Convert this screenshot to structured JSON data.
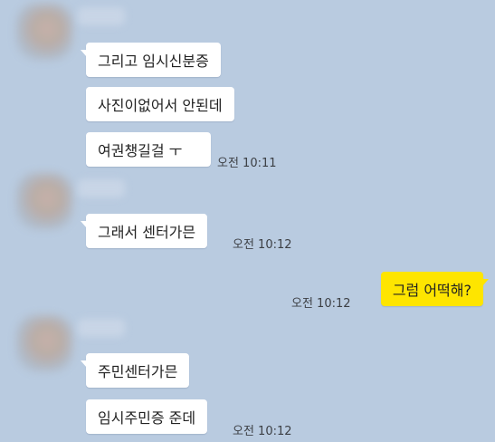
{
  "chat": {
    "group1": {
      "messages": [
        "그리고 임시신분증",
        "사진이없어서 안된데",
        "여권챙길걸 ㅜ"
      ],
      "time": "오전 10:11"
    },
    "group2": {
      "messages": [
        "그래서 센터가믄"
      ],
      "time": "오전 10:12"
    },
    "mine": {
      "message": "그럼 어떡해?",
      "time": "오전 10:12"
    },
    "group3": {
      "messages": [
        "주민센터가믄",
        "임시주민증 준데"
      ],
      "time": "오전 10:12"
    }
  },
  "colors": {
    "background": "#b9cbe0",
    "my_bubble": "#fee500",
    "other_bubble": "#ffffff"
  }
}
